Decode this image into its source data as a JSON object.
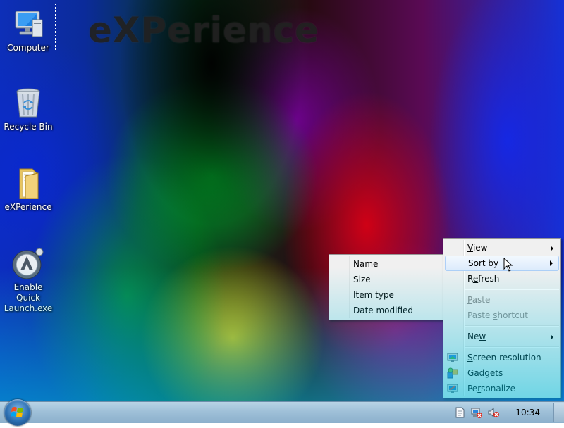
{
  "desktop": {
    "watermark": "eXPerience",
    "icons": [
      {
        "label": "Computer",
        "icon": "computer-icon"
      },
      {
        "label": "Recycle Bin",
        "icon": "recycle-bin-icon"
      },
      {
        "label": "eXPerience",
        "icon": "folder-icon"
      },
      {
        "label": "Enable Quick Launch.exe",
        "icon": "application-icon"
      }
    ]
  },
  "context_menu": {
    "items": [
      {
        "label": "View",
        "accel": "V",
        "submenu": true
      },
      {
        "label": "Sort by",
        "accel": "o",
        "submenu": true,
        "highlighted": true
      },
      {
        "label": "Refresh",
        "accel": "e"
      },
      {
        "label": "Paste",
        "accel": "P",
        "disabled": true
      },
      {
        "label": "Paste shortcut",
        "accel": "s",
        "disabled": true
      },
      {
        "label": "New",
        "accel": "w",
        "submenu": true
      },
      {
        "label": "Screen resolution",
        "accel": "c",
        "icon": "screen-resolution-icon"
      },
      {
        "label": "Gadgets",
        "accel": "G",
        "icon": "gadgets-icon"
      },
      {
        "label": "Personalize",
        "accel": "r",
        "icon": "personalize-icon"
      }
    ]
  },
  "sort_submenu": {
    "items": [
      "Name",
      "Size",
      "Item type",
      "Date modified"
    ]
  },
  "taskbar": {
    "clock": "10:34",
    "tray_icons": [
      "action-center-icon",
      "network-icon",
      "volume-muted-icon"
    ]
  },
  "colors": {
    "menu_background": "#f0f0f0",
    "menu_highlight": "#dcebfc",
    "taskbar": "#a8c6dc"
  }
}
